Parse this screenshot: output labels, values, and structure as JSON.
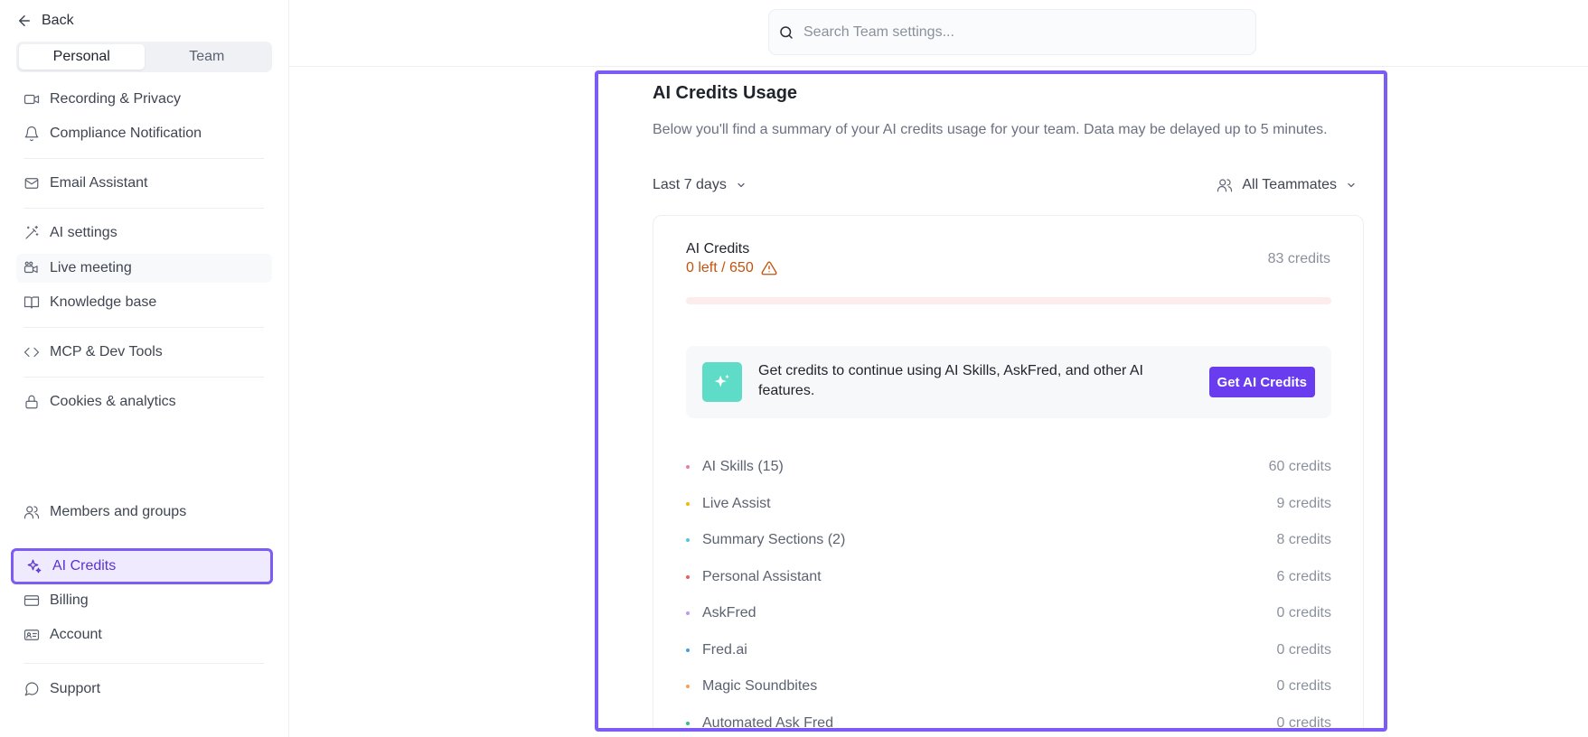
{
  "sidebar": {
    "back_label": "Back",
    "tabs": [
      {
        "label": "Personal",
        "active": true
      },
      {
        "label": "Team",
        "active": false
      }
    ],
    "items": [
      {
        "label": "Recording & Privacy",
        "icon": "video-icon"
      },
      {
        "label": "Compliance Notification",
        "icon": "bell-icon"
      },
      {
        "label": "Email Assistant",
        "icon": "mail-icon"
      },
      {
        "label": "AI settings",
        "icon": "magic-wand-icon"
      },
      {
        "label": "Live meeting",
        "icon": "live-video-icon"
      },
      {
        "label": "Knowledge base",
        "icon": "book-icon"
      },
      {
        "label": "MCP & Dev Tools",
        "icon": "code-icon"
      },
      {
        "label": "Cookies & analytics",
        "icon": "lock-icon"
      },
      {
        "label": "Members and groups",
        "icon": "users-icon"
      },
      {
        "label": "AI Credits",
        "icon": "sparkle-icon",
        "selected": true
      },
      {
        "label": "Billing",
        "icon": "credit-card-icon"
      },
      {
        "label": "Account",
        "icon": "id-card-icon"
      },
      {
        "label": "Support",
        "icon": "chat-bubble-icon"
      }
    ]
  },
  "search": {
    "placeholder": "Search Team settings..."
  },
  "main": {
    "title": "AI Credits Usage",
    "description": "Below you'll find a summary of your AI credits usage for your team. Data may be delayed up to 5 minutes.",
    "range_label": "Last 7 days",
    "teammates_label": "All Teammates",
    "card": {
      "label": "AI Credits",
      "left_text": "0 left / 650",
      "total": "83 credits",
      "progress_fraction": 0,
      "promo_text": "Get credits to continue using AI Skills, AskFred, and other AI features.",
      "promo_button": "Get AI Credits"
    },
    "usage": [
      {
        "name": "AI Skills (15)",
        "credits": "60 credits",
        "color": "#f07aa8"
      },
      {
        "name": "Live Assist",
        "credits": "9 credits",
        "color": "#f5b700"
      },
      {
        "name": "Summary Sections (2)",
        "credits": "8 credits",
        "color": "#4fc6e0"
      },
      {
        "name": "Personal Assistant",
        "credits": "6 credits",
        "color": "#f05a5a"
      },
      {
        "name": "AskFred",
        "credits": "0 credits",
        "color": "#b89af0"
      },
      {
        "name": "Fred.ai",
        "credits": "0 credits",
        "color": "#3fa0e0"
      },
      {
        "name": "Magic Soundbites",
        "credits": "0 credits",
        "color": "#f5a05a"
      },
      {
        "name": "Automated Ask Fred",
        "credits": "0 credits",
        "color": "#2ec27e"
      }
    ]
  },
  "colors": {
    "accent": "#7c5cf5",
    "button": "#6a3cf0",
    "warning": "#c2530e",
    "promo_icon": "#5fdcc8"
  }
}
